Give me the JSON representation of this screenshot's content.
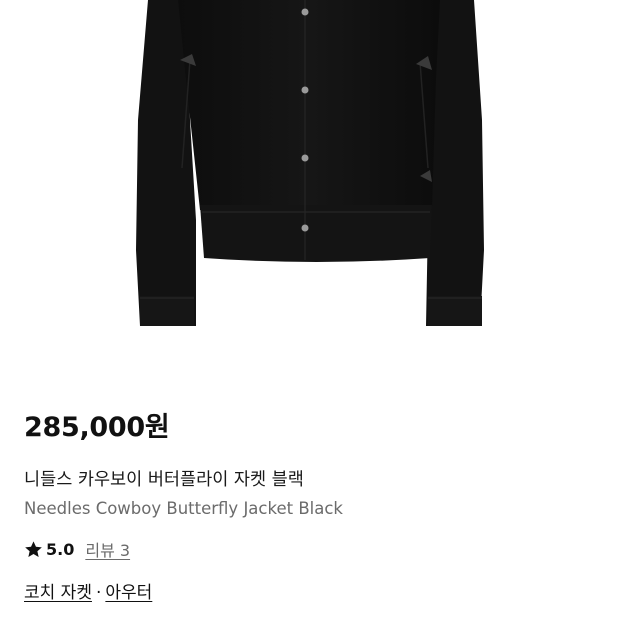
{
  "product": {
    "price": "285,000원",
    "name_ko": "니들스 카우보이 버터플라이 자켓 블랙",
    "name_en": "Needles Cowboy Butterfly Jacket Black",
    "image_icon": "product-photo-black-jacket"
  },
  "rating": {
    "icon": "star-icon",
    "score": "5.0",
    "score_value": 5.0,
    "review_label": "리뷰 3",
    "review_count": 3
  },
  "categories": {
    "items": [
      "코치 자켓",
      "아우터"
    ],
    "separator": "·"
  },
  "colors": {
    "price": "#111111",
    "subtitle": "#6b6b6b",
    "jacket": "#111111"
  }
}
